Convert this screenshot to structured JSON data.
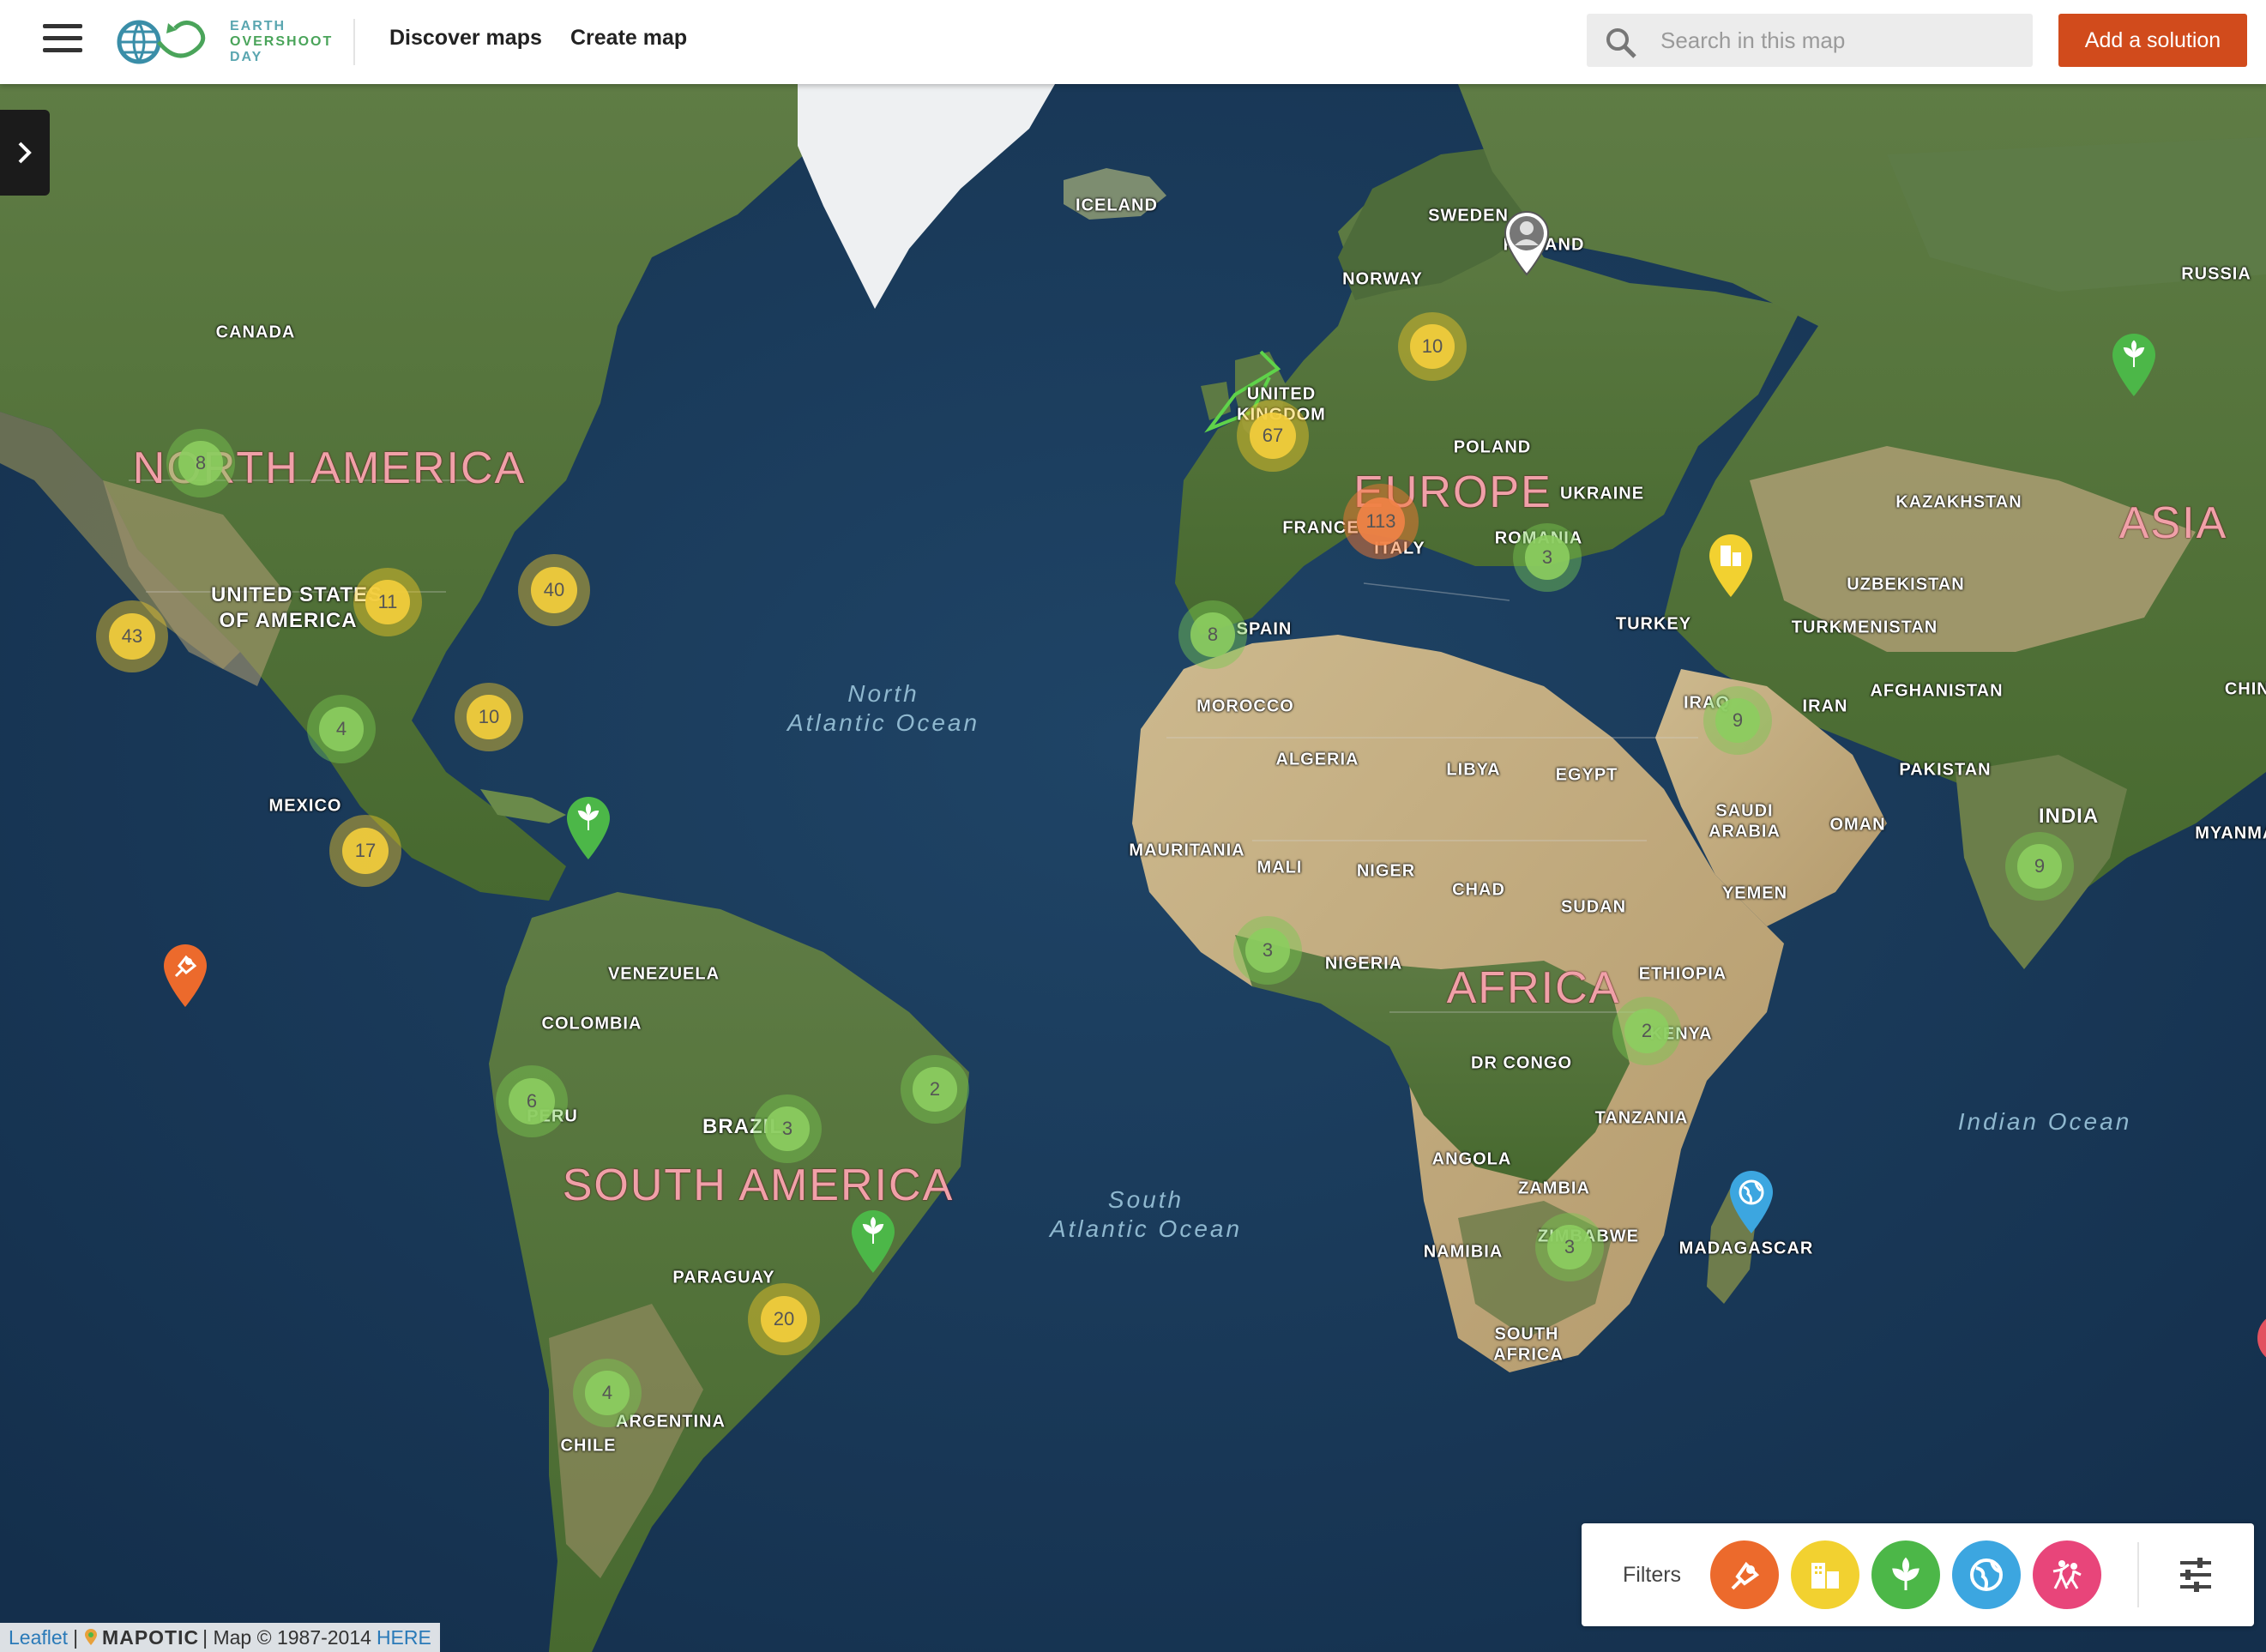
{
  "header": {
    "logo_lines": [
      "EARTH",
      "OVERSHOOT",
      "DAY"
    ],
    "nav": {
      "discover": "Discover maps",
      "create": "Create map"
    },
    "search_placeholder": "Search in this map",
    "add_solution": "Add a solution"
  },
  "labels": {
    "countries": [
      {
        "text": "ICELAND"
      },
      {
        "text": "SWEDEN"
      },
      {
        "text": "FINLAND"
      },
      {
        "text": "NORWAY"
      },
      {
        "text": "RUSSIA"
      },
      {
        "text": "CANADA"
      },
      {
        "text": "UNITED"
      },
      {
        "text": "KINGDOM"
      },
      {
        "text": "POLAND"
      },
      {
        "text": "UKRAINE"
      },
      {
        "text": "KAZAKHSTAN"
      },
      {
        "text": "FRANCE"
      },
      {
        "text": "ITALY"
      },
      {
        "text": "ROMANIA"
      },
      {
        "text": "UNITED STATES"
      },
      {
        "text": "OF AMERICA"
      },
      {
        "text": "UZBEKISTAN"
      },
      {
        "text": "SPAIN"
      },
      {
        "text": "TURKEY"
      },
      {
        "text": "TURKMENISTAN"
      },
      {
        "text": "IRAQ"
      },
      {
        "text": "IRAN"
      },
      {
        "text": "AFGHANISTAN"
      },
      {
        "text": "CHINA"
      },
      {
        "text": "MOROCCO"
      },
      {
        "text": "ALGERIA"
      },
      {
        "text": "LIBYA"
      },
      {
        "text": "EGYPT"
      },
      {
        "text": "PAKISTAN"
      },
      {
        "text": "MEXICO"
      },
      {
        "text": "SAUDI"
      },
      {
        "text": "ARABIA"
      },
      {
        "text": "OMAN"
      },
      {
        "text": "INDIA"
      },
      {
        "text": "MYANMAR"
      },
      {
        "text": "MAURITANIA"
      },
      {
        "text": "MALI"
      },
      {
        "text": "NIGER"
      },
      {
        "text": "CHAD"
      },
      {
        "text": "SUDAN"
      },
      {
        "text": "YEMEN"
      },
      {
        "text": "VENEZUELA"
      },
      {
        "text": "NIGERIA"
      },
      {
        "text": "ETHIOPIA"
      },
      {
        "text": "COLOMBIA"
      },
      {
        "text": "DR CONGO"
      },
      {
        "text": "KENYA"
      },
      {
        "text": "TANZANIA"
      },
      {
        "text": "PERU"
      },
      {
        "text": "BRAZIL"
      },
      {
        "text": "ANGOLA"
      },
      {
        "text": "ZAMBIA"
      },
      {
        "text": "NAMIBIA"
      },
      {
        "text": "ZIMBABWE"
      },
      {
        "text": "MADAGASCAR"
      },
      {
        "text": "PARAGUAY"
      },
      {
        "text": "SOUTH"
      },
      {
        "text": "AFRICA"
      },
      {
        "text": "ARGENTINA"
      },
      {
        "text": "CHILE"
      }
    ],
    "continents": [
      {
        "text": "NORTH AMERICA"
      },
      {
        "text": "EUROPE"
      },
      {
        "text": "ASIA"
      },
      {
        "text": "AFRICA"
      },
      {
        "text": "SOUTH AMERICA"
      }
    ],
    "oceans": [
      {
        "text": "North\nAtlantic Ocean"
      },
      {
        "text": "South\nAtlantic Ocean"
      },
      {
        "text": "Indian Ocean"
      }
    ]
  },
  "clusters": [
    {
      "count": "8",
      "color": "green"
    },
    {
      "count": "10",
      "color": "yellow"
    },
    {
      "count": "67",
      "color": "yellow"
    },
    {
      "count": "113",
      "color": "orange"
    },
    {
      "count": "3",
      "color": "green"
    },
    {
      "count": "8",
      "color": "green"
    },
    {
      "count": "9",
      "color": "green"
    },
    {
      "count": "9",
      "color": "green"
    },
    {
      "count": "43",
      "color": "yellow"
    },
    {
      "count": "11",
      "color": "yellow"
    },
    {
      "count": "40",
      "color": "yellow"
    },
    {
      "count": "4",
      "color": "green"
    },
    {
      "count": "10",
      "color": "yellow"
    },
    {
      "count": "17",
      "color": "yellow"
    },
    {
      "count": "3",
      "color": "green"
    },
    {
      "count": "2",
      "color": "green"
    },
    {
      "count": "6",
      "color": "green"
    },
    {
      "count": "3",
      "color": "green"
    },
    {
      "count": "2",
      "color": "green"
    },
    {
      "count": "3",
      "color": "green"
    },
    {
      "count": "20",
      "color": "yellow"
    },
    {
      "count": "4",
      "color": "green"
    }
  ],
  "pins": [
    {
      "type": "avatar",
      "color": "#ffffff",
      "icon": "person-avatar-icon"
    },
    {
      "type": "nature",
      "color": "#4cb748",
      "icon": "leaf-icon"
    },
    {
      "type": "buildings",
      "color": "#f2d130",
      "icon": "building-icon"
    },
    {
      "type": "nature",
      "color": "#4cb748",
      "icon": "leaf-icon"
    },
    {
      "type": "energy",
      "color": "#ec6a2c",
      "icon": "plug-icon"
    },
    {
      "type": "nature",
      "color": "#4cb748",
      "icon": "leaf-icon"
    },
    {
      "type": "global",
      "color": "#3ca6e0",
      "icon": "globe-icon"
    }
  ],
  "filters": {
    "label": "Filters",
    "items": [
      {
        "name": "energy",
        "color": "#ec6a2c",
        "icon": "plug-icon"
      },
      {
        "name": "cities",
        "color": "#f2d130",
        "icon": "building-icon"
      },
      {
        "name": "food",
        "color": "#4cb748",
        "icon": "leaf-icon"
      },
      {
        "name": "planet",
        "color": "#3ca6e0",
        "icon": "globe-icon"
      },
      {
        "name": "population",
        "color": "#e8457a",
        "icon": "people-icon"
      }
    ],
    "settings_icon": "sliders-icon"
  },
  "attribution": {
    "leaflet": "Leaflet",
    "sep": "|",
    "mapotic": "MAPOTIC",
    "map_credit": "| Map © 1987-2014",
    "here": "HERE"
  }
}
